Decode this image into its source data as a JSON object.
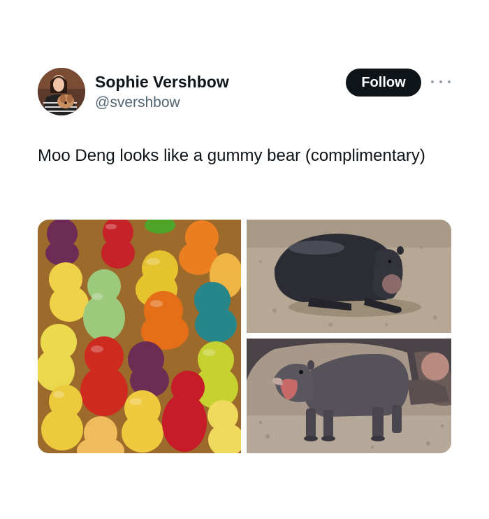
{
  "author": {
    "display_name": "Sophie Vershbow",
    "handle": "@svershbow"
  },
  "actions": {
    "follow_label": "Follow"
  },
  "post": {
    "text": "Moo Deng looks like a gummy bear (complimentary)"
  },
  "media": {
    "images": [
      {
        "depicts": "gummy-bears"
      },
      {
        "depicts": "baby-pygmy-hippo-lying"
      },
      {
        "depicts": "baby-pygmy-hippo-mouth-open"
      }
    ]
  },
  "icons": {
    "more": "more-icon",
    "avatar": "avatar"
  },
  "colors": {
    "follow_button_bg": "#0f1419",
    "follow_button_text": "#ffffff",
    "primary_text": "#0f1419",
    "secondary_text": "#536471"
  }
}
